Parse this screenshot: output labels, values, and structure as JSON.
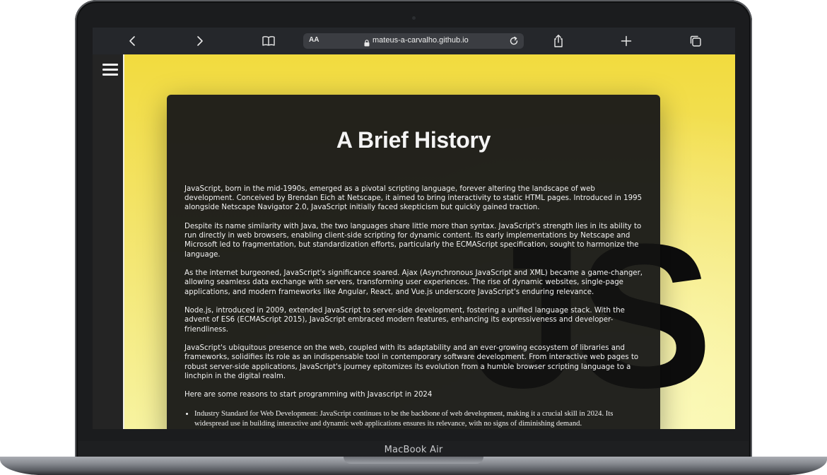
{
  "device": {
    "model_label": "MacBook Air"
  },
  "browser": {
    "text_size_label": "AA",
    "url": "mateus-a-carvalho.github.io",
    "icons": [
      "chevron-left-icon",
      "chevron-right-icon",
      "book-icon",
      "lock-icon",
      "reload-icon",
      "share-icon",
      "plus-icon",
      "tabs-icon"
    ]
  },
  "page": {
    "background_gradient": [
      "#f2db3e",
      "#f7f3a0"
    ],
    "sidebar_color": "#242424",
    "watermark": "JS",
    "title": "A Brief History",
    "paragraphs": [
      "JavaScript, born in the mid-1990s, emerged as a pivotal scripting language, forever altering the landscape of web development. Conceived by Brendan Eich at Netscape, it aimed to bring interactivity to static HTML pages. Introduced in 1995 alongside Netscape Navigator 2.0, JavaScript initially faced skepticism but quickly gained traction.",
      "Despite its name similarity with Java, the two languages share little more than syntax. JavaScript's strength lies in its ability to run directly in web browsers, enabling client-side scripting for dynamic content. Its early implementations by Netscape and Microsoft led to fragmentation, but standardization efforts, particularly the ECMAScript specification, sought to harmonize the language.",
      "As the internet burgeoned, JavaScript's significance soared. Ajax (Asynchronous JavaScript and XML) became a game-changer, allowing seamless data exchange with servers, transforming user experiences. The rise of dynamic websites, single-page applications, and modern frameworks like Angular, React, and Vue.js underscore JavaScript's enduring relevance.",
      "Node.js, introduced in 2009, extended JavaScript to server-side development, fostering a unified language stack. With the advent of ES6 (ECMAScript 2015), JavaScript embraced modern features, enhancing its expressiveness and developer-friendliness.",
      "JavaScript's ubiquitous presence on the web, coupled with its adaptability and an ever-growing ecosystem of libraries and frameworks, solidifies its role as an indispensable tool in contemporary software development. From interactive web pages to robust server-side applications, JavaScript's journey epitomizes its evolution from a humble browser scripting language to a linchpin in the digital realm."
    ],
    "reasons_intro": "Here are some reasons to start programming with Javascript in 2024",
    "reasons": [
      "Industry Standard for Web Development: JavaScript continues to be the backbone of web development, making it a crucial skill in 2024. Its widespread use in building interactive and dynamic web applications ensures its relevance, with no signs of diminishing demand."
    ]
  }
}
